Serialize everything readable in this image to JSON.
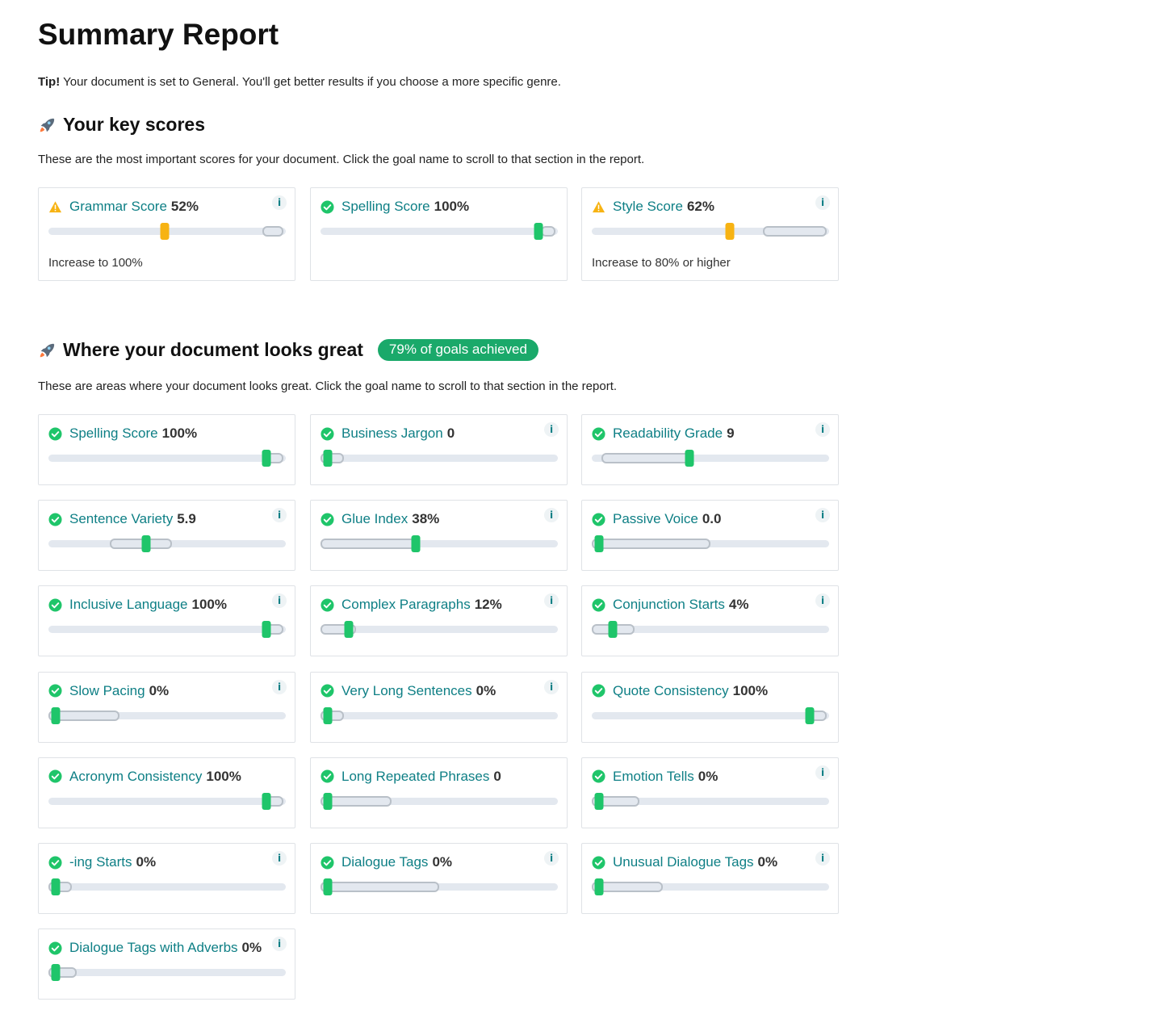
{
  "title": "Summary Report",
  "tip": {
    "bold": "Tip!",
    "text": " Your document is set to General. You'll get better results if you choose a more specific genre."
  },
  "key_scores": {
    "heading": "Your key scores",
    "description": "These are the most important scores for your document. Click the goal name to scroll to that section in the report.",
    "cards": [
      {
        "name": "Grammar Score",
        "value": "52%",
        "status": "warning",
        "info": true,
        "marker": 0.49,
        "target": [
          0.9,
          0.99
        ],
        "hint": "Increase to 100%"
      },
      {
        "name": "Spelling Score",
        "value": "100%",
        "status": "ok",
        "info": false,
        "marker": 0.92,
        "target": [
          0.93,
          0.99
        ],
        "hint": ""
      },
      {
        "name": "Style Score",
        "value": "62%",
        "status": "warning",
        "info": true,
        "marker": 0.58,
        "target": [
          0.72,
          0.99
        ],
        "hint": "Increase to 80% or higher"
      }
    ]
  },
  "great": {
    "heading": "Where your document looks great",
    "badge": "79% of goals achieved",
    "description": "These are areas where your document looks great. Click the goal name to scroll to that section in the report.",
    "cards": [
      {
        "name": "Spelling Score",
        "value": "100%",
        "status": "ok",
        "info": false,
        "marker": 0.92,
        "target": [
          0.92,
          0.99
        ]
      },
      {
        "name": "Business Jargon",
        "value": "0",
        "status": "ok",
        "info": true,
        "marker": 0.03,
        "target": [
          0.0,
          0.1
        ]
      },
      {
        "name": "Readability Grade",
        "value": "9",
        "status": "ok",
        "info": true,
        "marker": 0.41,
        "target": [
          0.04,
          0.42
        ]
      },
      {
        "name": "Sentence Variety",
        "value": "5.9",
        "status": "ok",
        "info": true,
        "marker": 0.41,
        "target": [
          0.26,
          0.52
        ]
      },
      {
        "name": "Glue Index",
        "value": "38%",
        "status": "ok",
        "info": true,
        "marker": 0.4,
        "target": [
          0.0,
          0.4
        ]
      },
      {
        "name": "Passive Voice",
        "value": "0.0",
        "status": "ok",
        "info": true,
        "marker": 0.03,
        "target": [
          0.0,
          0.5
        ]
      },
      {
        "name": "Inclusive Language",
        "value": "100%",
        "status": "ok",
        "info": true,
        "marker": 0.92,
        "target": [
          0.91,
          0.99
        ]
      },
      {
        "name": "Complex Paragraphs",
        "value": "12%",
        "status": "ok",
        "info": true,
        "marker": 0.12,
        "target": [
          0.0,
          0.15
        ]
      },
      {
        "name": "Conjunction Starts",
        "value": "4%",
        "status": "ok",
        "info": true,
        "marker": 0.09,
        "target": [
          0.0,
          0.18
        ]
      },
      {
        "name": "Slow Pacing",
        "value": "0%",
        "status": "ok",
        "info": true,
        "marker": 0.03,
        "target": [
          0.0,
          0.3
        ]
      },
      {
        "name": "Very Long Sentences",
        "value": "0%",
        "status": "ok",
        "info": true,
        "marker": 0.03,
        "target": [
          0.0,
          0.1
        ]
      },
      {
        "name": "Quote Consistency",
        "value": "100%",
        "status": "ok",
        "info": false,
        "marker": 0.92,
        "target": [
          0.92,
          0.99
        ]
      },
      {
        "name": "Acronym Consistency",
        "value": "100%",
        "status": "ok",
        "info": false,
        "marker": 0.92,
        "target": [
          0.92,
          0.99
        ]
      },
      {
        "name": "Long Repeated Phrases",
        "value": "0",
        "status": "ok",
        "info": false,
        "marker": 0.03,
        "target": [
          0.0,
          0.3
        ]
      },
      {
        "name": "Emotion Tells",
        "value": "0%",
        "status": "ok",
        "info": true,
        "marker": 0.03,
        "target": [
          0.0,
          0.2
        ]
      },
      {
        "name": "-ing Starts",
        "value": "0%",
        "status": "ok",
        "info": true,
        "marker": 0.03,
        "target": [
          0.0,
          0.1
        ]
      },
      {
        "name": "Dialogue Tags",
        "value": "0%",
        "status": "ok",
        "info": true,
        "marker": 0.03,
        "target": [
          0.0,
          0.5
        ]
      },
      {
        "name": "Unusual Dialogue Tags",
        "value": "0%",
        "status": "ok",
        "info": true,
        "marker": 0.03,
        "target": [
          0.0,
          0.3
        ]
      },
      {
        "name": "Dialogue Tags with Adverbs",
        "value": "0%",
        "status": "ok",
        "info": true,
        "marker": 0.03,
        "target": [
          0.0,
          0.12
        ]
      }
    ]
  },
  "info_label": "i",
  "colors": {
    "accent": "#1aa96a",
    "link": "#0e7f85",
    "ok": "#1fc56a",
    "warning": "#f7b313"
  },
  "icons": {
    "section": "rocket-icon",
    "ok": "check-circle-icon",
    "warning": "warning-triangle-icon",
    "info": "info-icon"
  }
}
